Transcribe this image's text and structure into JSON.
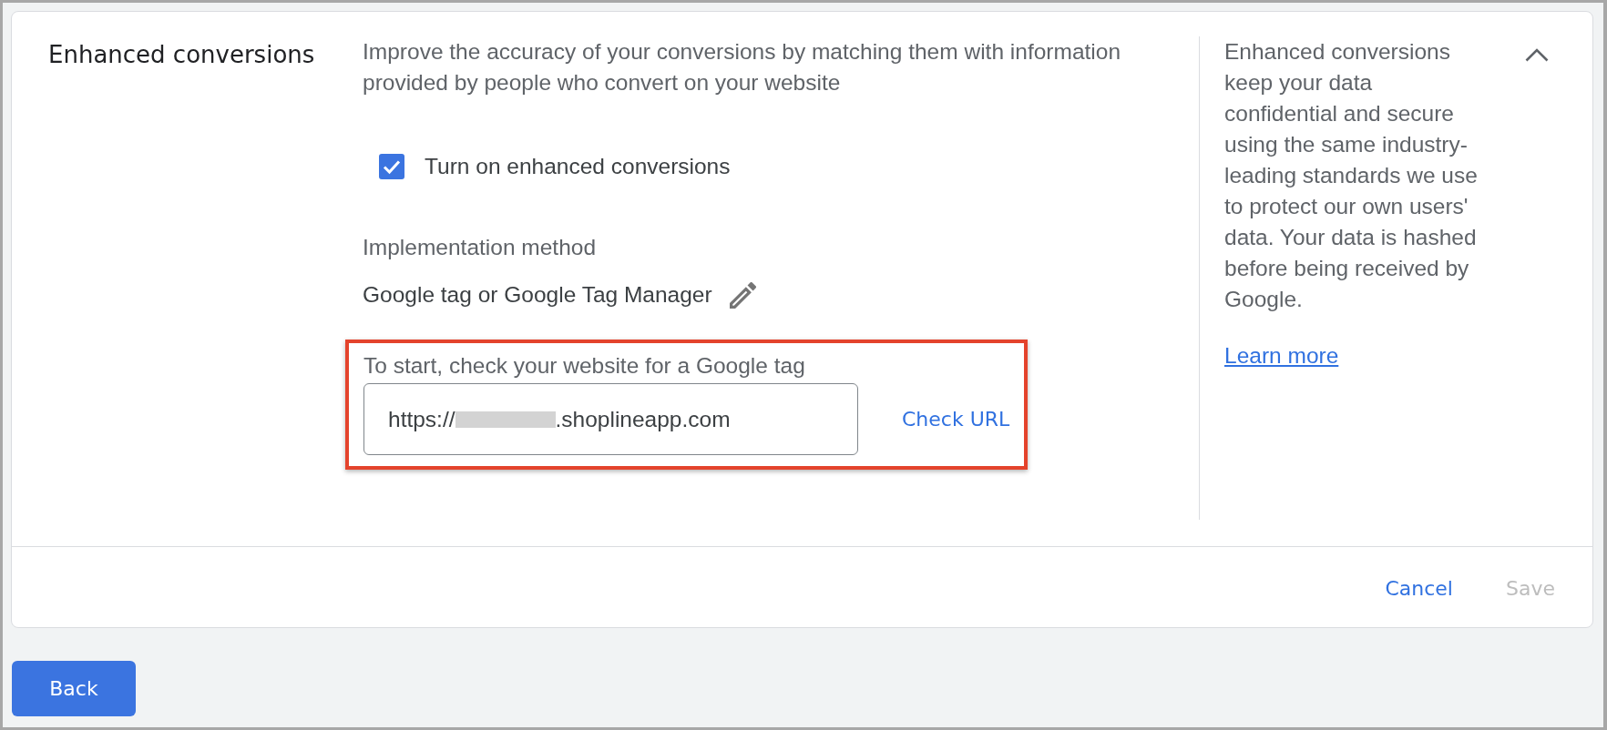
{
  "section": {
    "title": "Enhanced conversions",
    "expanded": true,
    "description": "Improve the accuracy of your conversions by matching them with information provided by people who convert on your website",
    "checkbox": {
      "label": "Turn on enhanced conversions",
      "checked": true
    },
    "implementation": {
      "label": "Implementation method",
      "value": "Google tag or Google Tag Manager"
    },
    "url_check": {
      "highlighted": true,
      "label": "To start, check your website for a Google tag",
      "field": {
        "value_start": "https://",
        "redacted": true,
        "value_end": ".shoplineapp.com"
      },
      "action": "Check URL"
    },
    "side_note": {
      "text": "Enhanced conversions keep your data confidential and secure using the same industry-leading standards we use to protect our own users' data. Your data is hashed before being received by Google.",
      "link": "Learn more"
    }
  },
  "footer": {
    "buttons": [
      {
        "label": "Cancel",
        "disabled": false
      },
      {
        "label": "Save",
        "disabled": true
      }
    ]
  },
  "back_button": {
    "label": "Back"
  }
}
